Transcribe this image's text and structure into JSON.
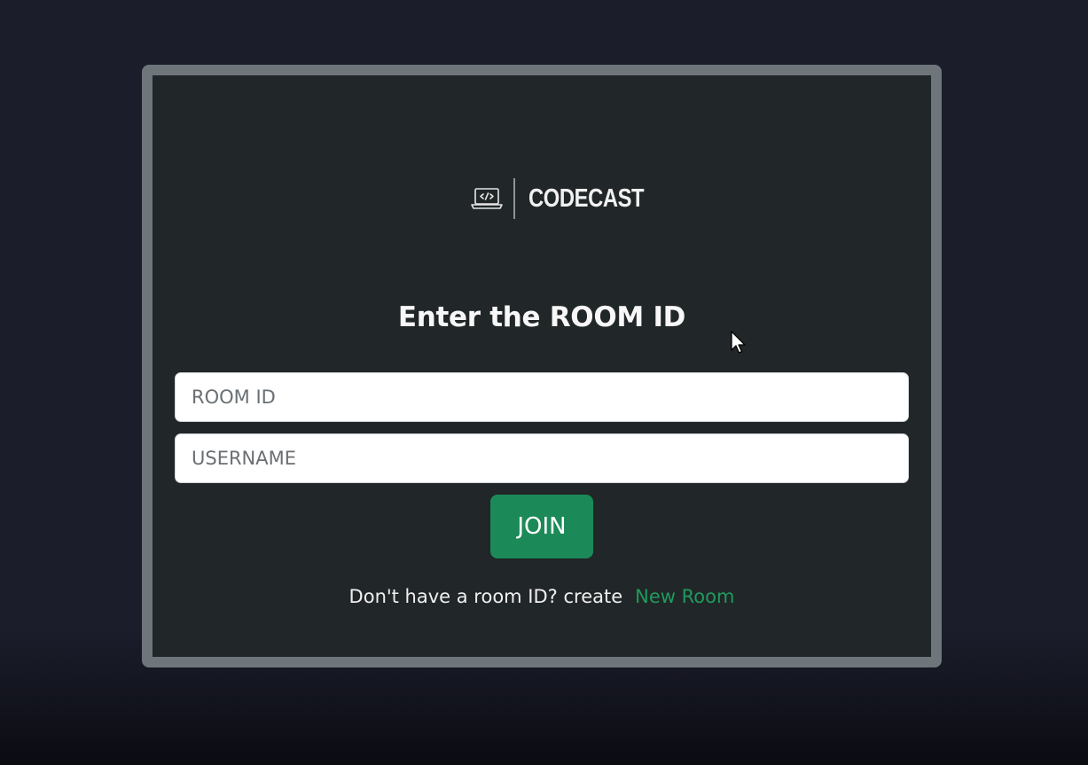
{
  "logo": {
    "icon": "laptop-code-icon",
    "name": "CODECAST"
  },
  "form": {
    "heading": "Enter the ROOM ID",
    "room_id_placeholder": "ROOM ID",
    "room_id_value": "",
    "username_placeholder": "USERNAME",
    "username_value": "",
    "join_label": "JOIN"
  },
  "footer": {
    "prompt": "Don't have a room ID? create",
    "link_label": "New Room"
  },
  "colors": {
    "background": "#1b1d2b",
    "card": "#212628",
    "card_border": "#6e757b",
    "accent": "#1b8a58",
    "link": "#1f9a5e"
  }
}
